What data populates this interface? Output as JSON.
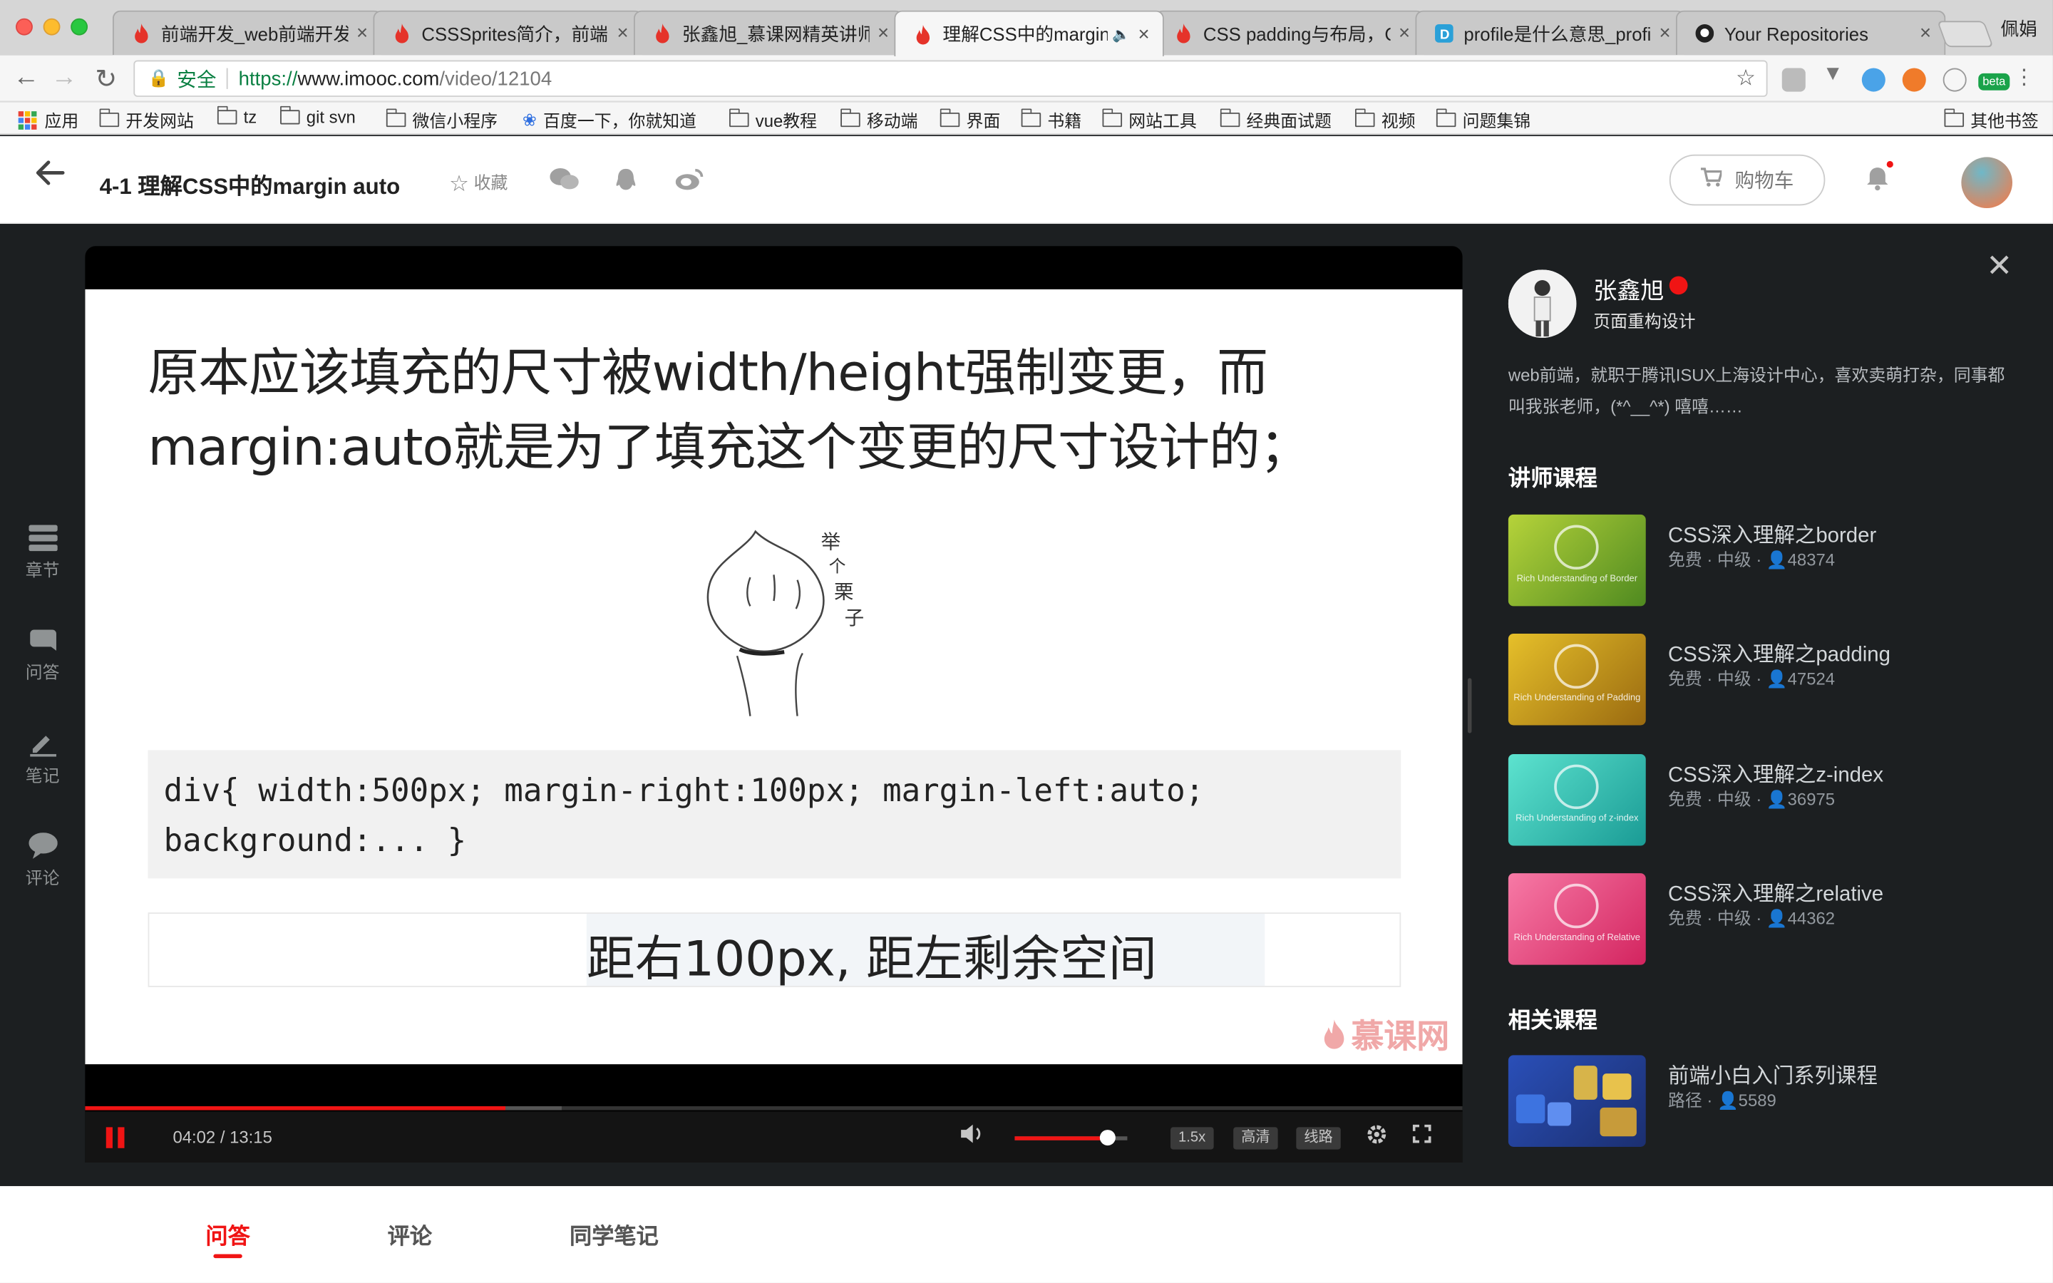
{
  "browser": {
    "tabs": [
      {
        "title": "前端开发_web前端开发",
        "favicon": "flame-icon"
      },
      {
        "title": "CSSSprites简介，前端",
        "favicon": "flame-icon"
      },
      {
        "title": "张鑫旭_慕课网精英讲师",
        "favicon": "flame-icon"
      },
      {
        "title": "理解CSS中的margin",
        "favicon": "flame-icon",
        "active": true,
        "audio": true
      },
      {
        "title": "CSS padding与布局，C",
        "favicon": "flame-icon"
      },
      {
        "title": "profile是什么意思_profi",
        "favicon": "d-icon"
      },
      {
        "title": "Your Repositories",
        "favicon": "github-icon"
      }
    ],
    "profile_name": "佩娟",
    "address": {
      "secure_label": "安全",
      "url_scheme": "https://",
      "url_host": "www.imooc.com",
      "url_path": "/video/12104"
    },
    "bookmarks": [
      "应用",
      "开发网站",
      "tz",
      "git svn",
      "微信小程序",
      "百度一下，你就知道",
      "vue教程",
      "移动端",
      "界面",
      "书籍",
      "网站工具",
      "经典面试题",
      "视频",
      "问题集锦"
    ],
    "other_bookmarks": "其他书签"
  },
  "header": {
    "title": "4-1 理解CSS中的margin auto",
    "collect_label": "收藏",
    "cart_label": "购物车"
  },
  "side_nav": [
    {
      "label": "章节",
      "icon": "chapters-icon"
    },
    {
      "label": "问答",
      "icon": "qa-icon"
    },
    {
      "label": "笔记",
      "icon": "note-icon"
    },
    {
      "label": "评论",
      "icon": "comment-icon"
    }
  ],
  "slide": {
    "line1": "原本应该填充的尺寸被width/height强制变更，而",
    "line2": "margin:auto就是为了填充这个变更的尺寸设计的；",
    "doodle_text": [
      "举",
      "个",
      "栗",
      "子"
    ],
    "code_line1": "div{ width:500px; margin-right:100px; margin-left:auto;",
    "code_line2": "background:... }",
    "answer": "距右100px, 距左剩余空间",
    "watermark": "慕课网"
  },
  "player": {
    "time": "04:02 / 13:15",
    "progress": 0.305,
    "buffered": 0.346,
    "volume": 0.82,
    "speed_label": "1.5x",
    "quality_label": "高清",
    "line_label": "线路"
  },
  "teacher": {
    "name": "张鑫旭",
    "role": "页面重构设计",
    "bio": "web前端，就职于腾讯ISUX上海设计中心，喜欢卖萌打杂，同事都叫我张老师，(*^__^*) 嘻嘻……"
  },
  "teacher_courses_heading": "讲师课程",
  "teacher_courses": [
    {
      "name": "CSS深入理解之border",
      "meta": "免费 · 中级 · ",
      "students": "48374",
      "thumb_caption": "Rich Understanding of Border",
      "color_a": "#b6d33a",
      "color_b": "#4f8a20"
    },
    {
      "name": "CSS深入理解之padding",
      "meta": "免费 · 中级 · ",
      "students": "47524",
      "thumb_caption": "Rich Understanding of Padding",
      "color_a": "#e6c02a",
      "color_b": "#9a6a10"
    },
    {
      "name": "CSS深入理解之z-index",
      "meta": "免费 · 中级 · ",
      "students": "36975",
      "thumb_caption": "Rich Understanding of z-index",
      "color_a": "#5de3cf",
      "color_b": "#1a9b95"
    },
    {
      "name": "CSS深入理解之relative",
      "meta": "免费 · 中级 · ",
      "students": "44362",
      "thumb_caption": "Rich Understanding of Relative",
      "color_a": "#f77aa6",
      "color_b": "#d3245f"
    }
  ],
  "related_heading": "相关课程",
  "related_courses": [
    {
      "name": "前端小白入门系列课程",
      "meta": "路径 · ",
      "students": "5589"
    }
  ],
  "bottom_tabs": [
    "问答",
    "评论",
    "同学笔记"
  ],
  "colors": {
    "accent": "#f01414",
    "dark_bg": "#1c1f21"
  }
}
